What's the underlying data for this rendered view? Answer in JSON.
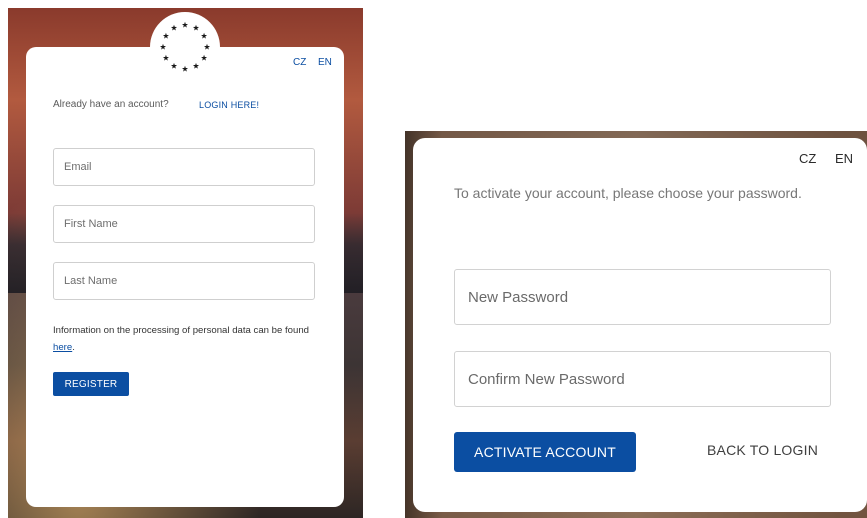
{
  "register_screen": {
    "lang": {
      "cz": "CZ",
      "en": "EN"
    },
    "already_text": "Already have an account?",
    "login_link": "LOGIN HERE!",
    "fields": {
      "email_placeholder": "Email",
      "first_name_placeholder": "First Name",
      "last_name_placeholder": "Last Name"
    },
    "info_text": "Information on the processing of personal data can be found ",
    "info_link": "here",
    "info_end": ".",
    "register_label": "REGISTER"
  },
  "activate_screen": {
    "lang": {
      "cz": "CZ",
      "en": "EN"
    },
    "instruction": "To activate your account, please choose your password.",
    "fields": {
      "new_password_placeholder": "New Password",
      "confirm_password_placeholder": "Confirm New Password"
    },
    "activate_label": "ACTIVATE ACCOUNT",
    "back_label": "BACK TO LOGIN"
  },
  "colors": {
    "accent": "#0b4ea2",
    "star_color": "#1a1a1a"
  },
  "icons": [
    "eu-stars-icon"
  ]
}
